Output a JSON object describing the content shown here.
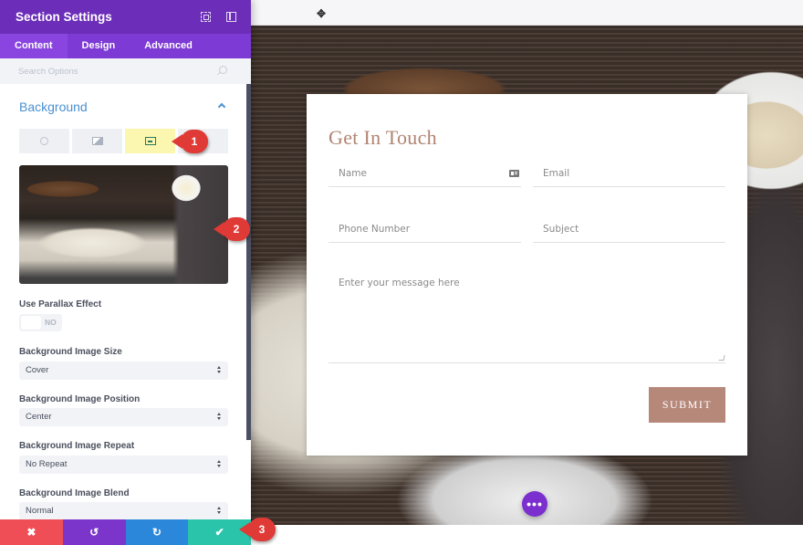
{
  "sidebar": {
    "title": "Section Settings",
    "header_icons": [
      "fullscreen-icon",
      "split-view-icon"
    ],
    "tabs": [
      {
        "label": "Content",
        "active": true
      },
      {
        "label": "Design",
        "active": false
      },
      {
        "label": "Advanced",
        "active": false
      }
    ],
    "search": {
      "placeholder": "Search Options"
    },
    "section": {
      "title": "Background",
      "expanded": true,
      "bg_type_tabs": [
        {
          "name": "color",
          "icon": "paint-bucket-icon",
          "active": false
        },
        {
          "name": "gradient",
          "icon": "gradient-icon",
          "active": false
        },
        {
          "name": "image",
          "icon": "image-icon",
          "active": true
        },
        {
          "name": "video",
          "icon": "",
          "active": false
        }
      ],
      "parallax": {
        "label": "Use Parallax Effect",
        "value": "NO"
      },
      "image_size": {
        "label": "Background Image Size",
        "value": "Cover"
      },
      "image_position": {
        "label": "Background Image Position",
        "value": "Center"
      },
      "image_repeat": {
        "label": "Background Image Repeat",
        "value": "No Repeat"
      },
      "image_blend": {
        "label": "Background Image Blend",
        "value": "Normal"
      }
    },
    "footer": {
      "cancel": "✖",
      "undo": "↺",
      "redo": "↻",
      "save": "✔"
    }
  },
  "callouts": [
    "1",
    "2",
    "3"
  ],
  "canvas": {
    "move_icon": "✥",
    "form": {
      "title": "Get In Touch",
      "name_placeholder": "Name",
      "email_placeholder": "Email",
      "phone_placeholder": "Phone Number",
      "subject_placeholder": "Subject",
      "message_placeholder": "Enter your message here",
      "submit_label": "SUBMIT"
    },
    "fab_label": "•••"
  },
  "colors": {
    "header_purple": "#6c2eb9",
    "tab_purple": "#7d3ad4",
    "accent_blue": "#4a90d0",
    "title_brown": "#b08472",
    "submit_brown": "#b6887a",
    "cancel_red": "#ef4e56",
    "undo_purple": "#7b35ca",
    "redo_blue": "#2b87da",
    "save_teal": "#29c4a9"
  }
}
